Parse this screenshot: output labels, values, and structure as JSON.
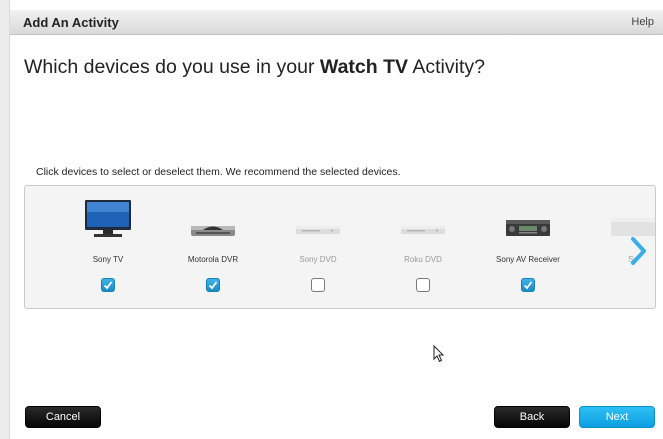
{
  "window": {
    "title": "Add An Activity",
    "help_label": "Help"
  },
  "question": {
    "prefix": "Which devices do you use in your ",
    "activity": "Watch TV",
    "suffix": " Activity?"
  },
  "instruction": "Click devices to select or deselect them. We recommend the selected devices.",
  "devices": [
    {
      "label": "Sony TV",
      "selected": true,
      "icon": "tv-icon"
    },
    {
      "label": "Motorola DVR",
      "selected": true,
      "icon": "dvr-icon"
    },
    {
      "label": "Sony DVD",
      "selected": false,
      "icon": "dvd-player-icon"
    },
    {
      "label": "Roku DVD",
      "selected": false,
      "icon": "dvd-player-icon"
    },
    {
      "label": "Sony AV Receiver",
      "selected": true,
      "icon": "av-receiver-icon"
    },
    {
      "label": "So",
      "selected": false,
      "icon": "device-icon"
    }
  ],
  "buttons": {
    "cancel": "Cancel",
    "back": "Back",
    "next": "Next"
  },
  "colors": {
    "accent": "#1a9fe0",
    "checkbox_selected": "#2aa3dc",
    "button_dark": "#111111"
  }
}
